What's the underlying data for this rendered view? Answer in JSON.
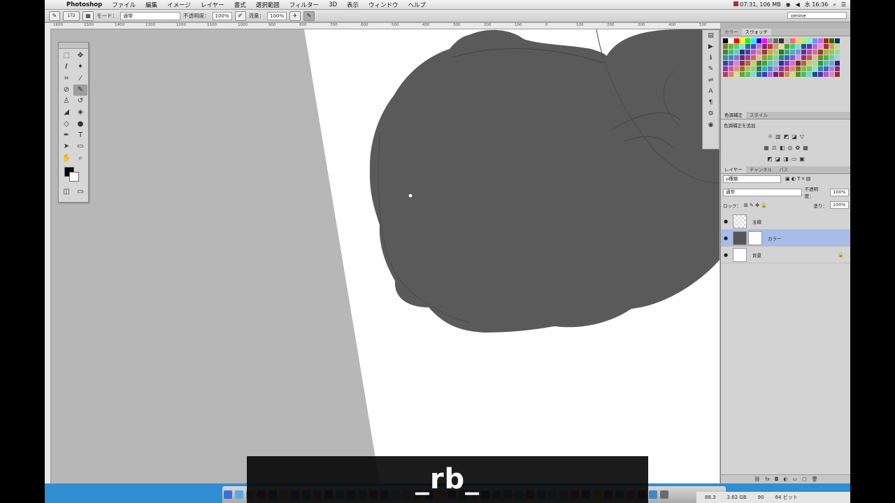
{
  "menubar": {
    "app": "Photoshop",
    "items": [
      "ファイル",
      "編集",
      "イメージ",
      "レイヤー",
      "書式",
      "選択範囲",
      "フィルター",
      "3D",
      "表示",
      "ウィンドウ",
      "ヘルプ"
    ],
    "status": "07:31, 106 MB",
    "clock": "水 16:36"
  },
  "options": {
    "brush_size": "172",
    "mode_label": "モード：",
    "mode_value": "通常",
    "opacity_label": "不透明度：",
    "opacity_value": "100%",
    "flow_label": "流量：",
    "flow_value": "100%",
    "workspace": "omine"
  },
  "ruler": [
    "1600",
    "1500",
    "1400",
    "1300",
    "1200",
    "1100",
    "1000",
    "900",
    "800",
    "700",
    "600",
    "500",
    "400",
    "300",
    "200",
    "100",
    "0",
    "100",
    "200",
    "300",
    "400",
    "500"
  ],
  "panels": {
    "color_tabs": [
      "カラー",
      "スウォッチ"
    ],
    "adjust_tabs": [
      "色調補正",
      "スタイル"
    ],
    "adjust_title": "色調補正を追加",
    "layer_tabs": [
      "レイヤー",
      "チャンネル",
      "パス"
    ],
    "layer_filter": "ρ種類",
    "blend_mode": "通常",
    "opacity_label": "不透明度：",
    "opacity_value": "100%",
    "lock_label": "ロック：",
    "fill_label": "塗り：",
    "fill_value": "100%",
    "layers": [
      {
        "name": "主線"
      },
      {
        "name": "カラー"
      },
      {
        "name": "背景"
      }
    ]
  },
  "statusbar": {
    "zoom": "88.3",
    "size": "2.62 GB",
    "angle": "90",
    "bits": "64 ビット"
  },
  "caption": "_rb_",
  "swatch_colors": [
    "#000000",
    "#ffffff",
    "#ff0000",
    "#ffff00",
    "#00ff00",
    "#00ffff",
    "#0000ff",
    "#ff00ff",
    "#999999",
    "#666666",
    "#333333",
    "#c0c0c0",
    "#ff6666",
    "#ffcc66",
    "#99ff66",
    "#66ffcc",
    "#6699ff",
    "#cc66ff",
    "#993300",
    "#336600",
    "#003366"
  ]
}
